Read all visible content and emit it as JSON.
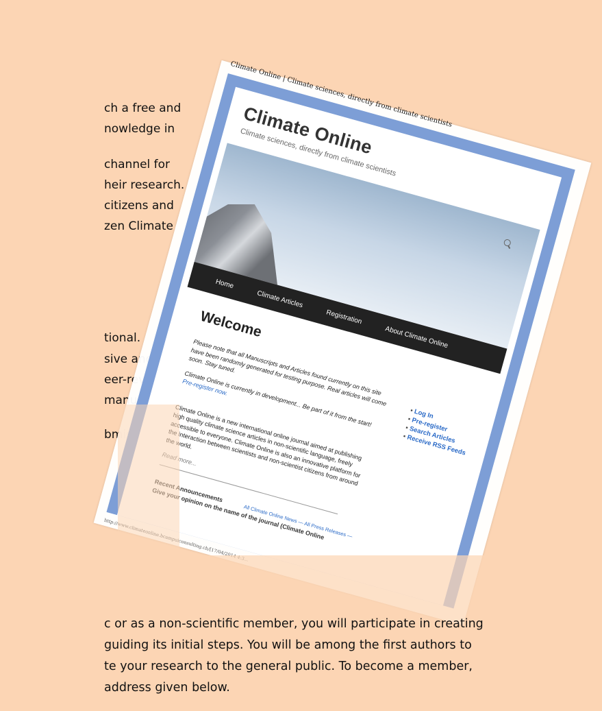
{
  "background_text": {
    "lines": [
      "ch a free and",
      "nowledge in",
      "channel for",
      "heir research.",
      "citizens and",
      "zen Climate",
      "tional.",
      "sive and fully",
      "eer-reviewing",
      "manuscripts",
      "bmissions of"
    ],
    "bottom_lines": [
      "c or as a non-scientific member, you will participate in creating",
      "guiding its initial steps. You will be among the first authors to",
      "te your research to the general public. To become a member,",
      "address given below."
    ]
  },
  "window": {
    "title": "Climate Online | Climate sciences, directly from climate scientists",
    "status_url": "http://www.climateonline.bcampuiconsulting.ch/[17/04/2014 4:3..."
  },
  "site": {
    "title": "Climate Online",
    "tagline": "Climate sciences, directly from climate scientists",
    "nav": [
      "Home",
      "Climate Articles",
      "Registration",
      "About Climate Online"
    ],
    "welcome": "Welcome",
    "notice": "Please note that all Manuscripts and Articles found currently on this site have been randomly generated for testing purpose. Real articles will come soon. Stay tuned.",
    "dev_text": "Climate Online is currently in development... Be part of it from the start!",
    "dev_link": "Pre-register now.",
    "intro": "Climate Online is a new international online journal aimed at publishing high quality climate science articles in non-scientific language, freely accessible to everyone. Climate Online is also an innovative platform for the interaction between scientists and non-scientist citizens from around the world.",
    "read_more": "Read more...",
    "sidebar": [
      "Log In",
      "Pre-register",
      "Search Articles",
      "Receive RSS Feeds"
    ],
    "announcements_heading": "Recent Announcements",
    "announcements_links": "All Climate Online News — All Press Releases —",
    "announcement_item": "Give your opinion on the name of the journal (Climate Online"
  },
  "colors": {
    "background": "#fcd5b4",
    "frame": "#7d9ed6",
    "navbar": "#222222",
    "link": "#2a6ac7"
  },
  "icons": [
    "search-icon"
  ]
}
